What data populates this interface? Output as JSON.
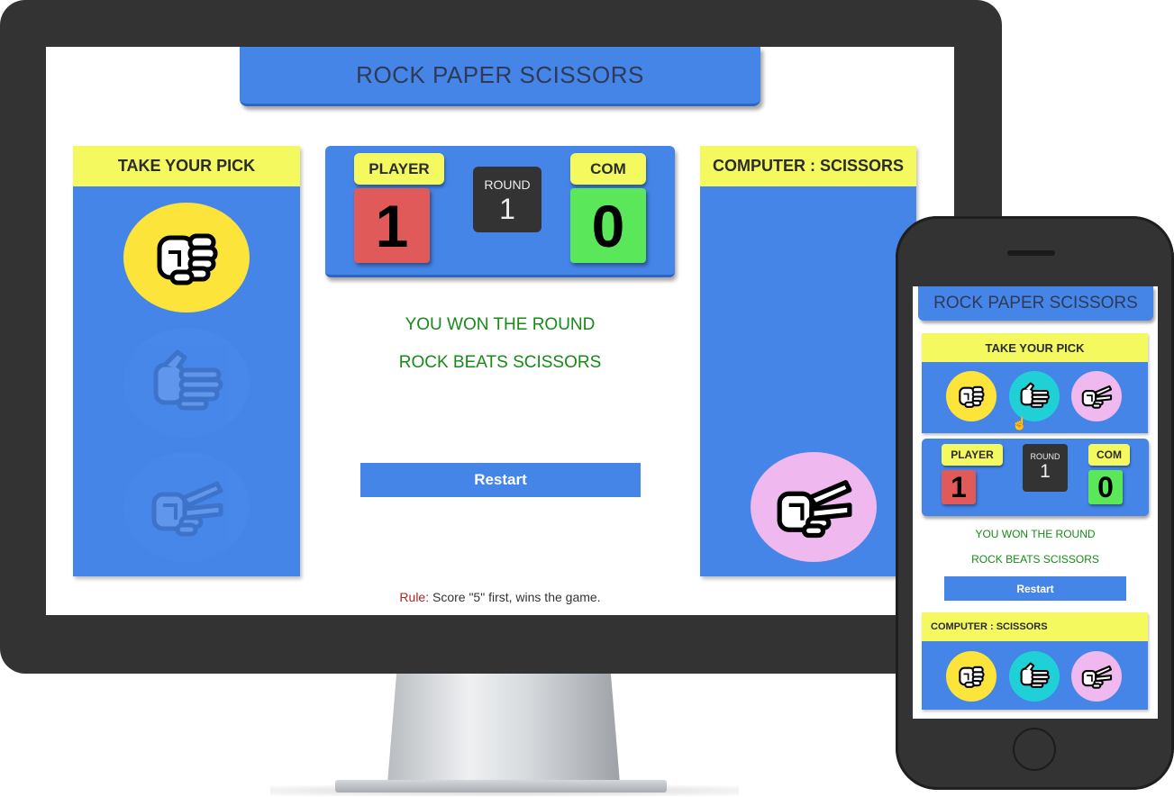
{
  "app": {
    "title": "ROCK PAPER SCISSORS"
  },
  "colors": {
    "primary": "#4585e8",
    "highlight": "#f4f960",
    "player_score": "#e05a5a",
    "com_score": "#5ae85a",
    "rock": "#fde43a",
    "paper": "#1fd1d6",
    "scissors": "#efb9f0",
    "result_text": "#178a17",
    "rule_label": "#b02424"
  },
  "desktop": {
    "pick_panel": {
      "heading": "TAKE YOUR PICK",
      "options": [
        {
          "name": "rock",
          "icon": "fist-hand-icon",
          "state": "selected"
        },
        {
          "name": "paper",
          "icon": "open-hand-icon",
          "state": "faded"
        },
        {
          "name": "scissors",
          "icon": "peace-hand-icon",
          "state": "faded"
        }
      ]
    },
    "scoreboard": {
      "player_label": "PLAYER",
      "player_score": "1",
      "round_label": "ROUND",
      "round_value": "1",
      "com_label": "COM",
      "com_score": "0"
    },
    "result": {
      "line1": "YOU WON THE ROUND",
      "line2": "ROCK BEATS SCISSORS"
    },
    "restart_label": "Restart",
    "computer_panel": {
      "heading": "COMPUTER : SCISSORS",
      "choice_icon": "peace-hand-icon"
    },
    "rule": {
      "label": "Rule:",
      "text": " Score \"5\" first, wins the game."
    }
  },
  "mobile": {
    "title": "ROCK PAPER SCISSORS",
    "pick_heading": "TAKE YOUR PICK",
    "scoreboard": {
      "player_label": "PLAYER",
      "player_score": "1",
      "round_label": "ROUND",
      "round_value": "1",
      "com_label": "COM",
      "com_score": "0"
    },
    "result": {
      "line1": "YOU WON THE ROUND",
      "line2": "ROCK BEATS SCISSORS"
    },
    "restart_label": "Restart",
    "computer_heading": "COMPUTER : SCISSORS"
  }
}
